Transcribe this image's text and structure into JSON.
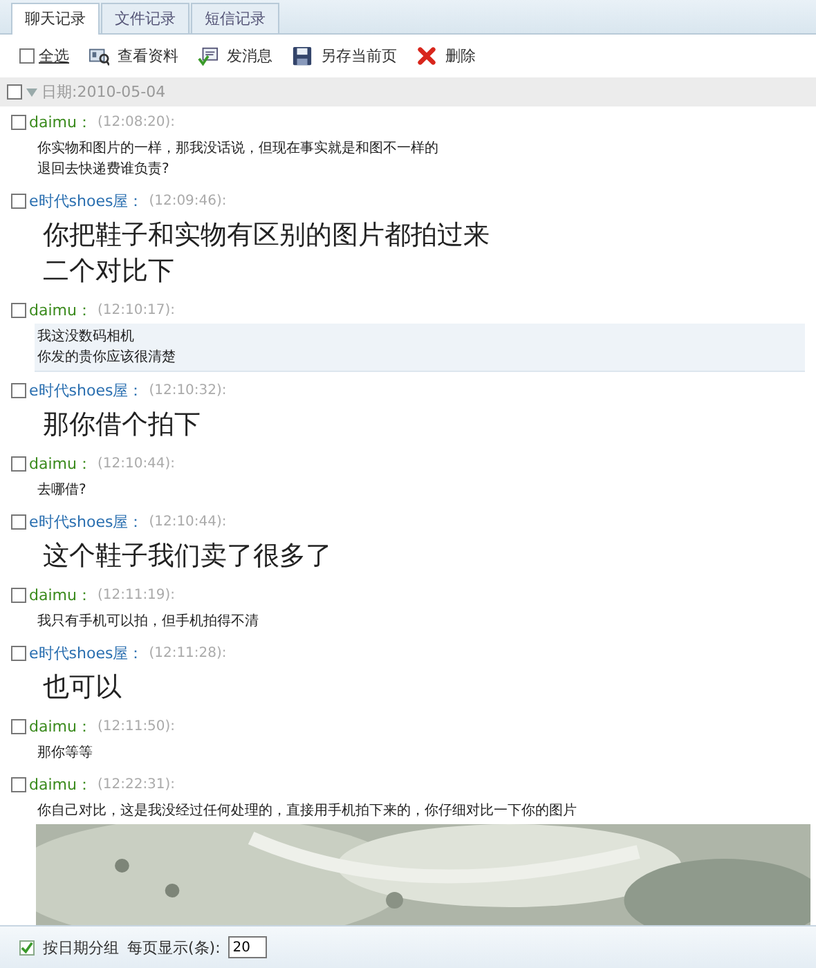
{
  "tabs": [
    {
      "label": "聊天记录",
      "selected": true
    },
    {
      "label": "文件记录",
      "selected": false
    },
    {
      "label": "短信记录",
      "selected": false
    }
  ],
  "toolbar": {
    "select_all": {
      "label": "全选",
      "checked": false
    },
    "buttons": [
      {
        "kind": "profile",
        "label": "查看资料"
      },
      {
        "kind": "message",
        "label": "发消息"
      },
      {
        "kind": "save",
        "label": "另存当前页"
      },
      {
        "kind": "delete",
        "label": "删除"
      }
    ]
  },
  "date_group": {
    "label": "日期:2010-05-04",
    "checked": false,
    "expanded": true
  },
  "messages": [
    {
      "sender": "daimu：",
      "color": "#3a8a1c",
      "time": "(12:08:20):",
      "large": false,
      "selected": false,
      "checked": false,
      "lines": [
        "你实物和图片的一样，那我没话说，但现在事实就是和图不一样的",
        "退回去快递费谁负责?"
      ]
    },
    {
      "sender": "e时代shoes屋：",
      "color": "#2a6fb0",
      "time": "(12:09:46):",
      "large": true,
      "selected": false,
      "checked": false,
      "lines": [
        "你把鞋子和实物有区别的图片都拍过来",
        "二个对比下"
      ]
    },
    {
      "sender": "daimu：",
      "color": "#3a8a1c",
      "time": "(12:10:17):",
      "large": false,
      "selected": true,
      "checked": false,
      "lines": [
        "我这没数码相机",
        "你发的贵你应该很清楚"
      ]
    },
    {
      "sender": "e时代shoes屋：",
      "color": "#2a6fb0",
      "time": "(12:10:32):",
      "large": true,
      "selected": false,
      "checked": false,
      "lines": [
        "那你借个拍下"
      ]
    },
    {
      "sender": "daimu：",
      "color": "#3a8a1c",
      "time": "(12:10:44):",
      "large": false,
      "selected": false,
      "checked": false,
      "lines": [
        "去哪借?"
      ]
    },
    {
      "sender": "e时代shoes屋：",
      "color": "#2a6fb0",
      "time": "(12:10:44):",
      "large": true,
      "selected": false,
      "checked": false,
      "lines": [
        "这个鞋子我们卖了很多了"
      ]
    },
    {
      "sender": "daimu：",
      "color": "#3a8a1c",
      "time": "(12:11:19):",
      "large": false,
      "selected": false,
      "checked": false,
      "lines": [
        "我只有手机可以拍，但手机拍得不清"
      ]
    },
    {
      "sender": "e时代shoes屋：",
      "color": "#2a6fb0",
      "time": "(12:11:28):",
      "large": true,
      "selected": false,
      "checked": false,
      "lines": [
        "也可以"
      ]
    },
    {
      "sender": "daimu：",
      "color": "#3a8a1c",
      "time": "(12:11:50):",
      "large": false,
      "selected": false,
      "checked": false,
      "lines": [
        "那你等等"
      ]
    },
    {
      "sender": "daimu：",
      "color": "#3a8a1c",
      "time": "(12:22:31):",
      "large": false,
      "selected": false,
      "checked": false,
      "lines": [
        "你自己对比，这是我没经过任何处理的，直接用手机拍下来的，你仔细对比一下你的图片"
      ],
      "attachment": {
        "kind": "picture"
      }
    }
  ],
  "footer": {
    "group_by_date": {
      "label": "按日期分组",
      "checked": true
    },
    "page_size_label": "每页显示(条):",
    "page_size": "20"
  }
}
